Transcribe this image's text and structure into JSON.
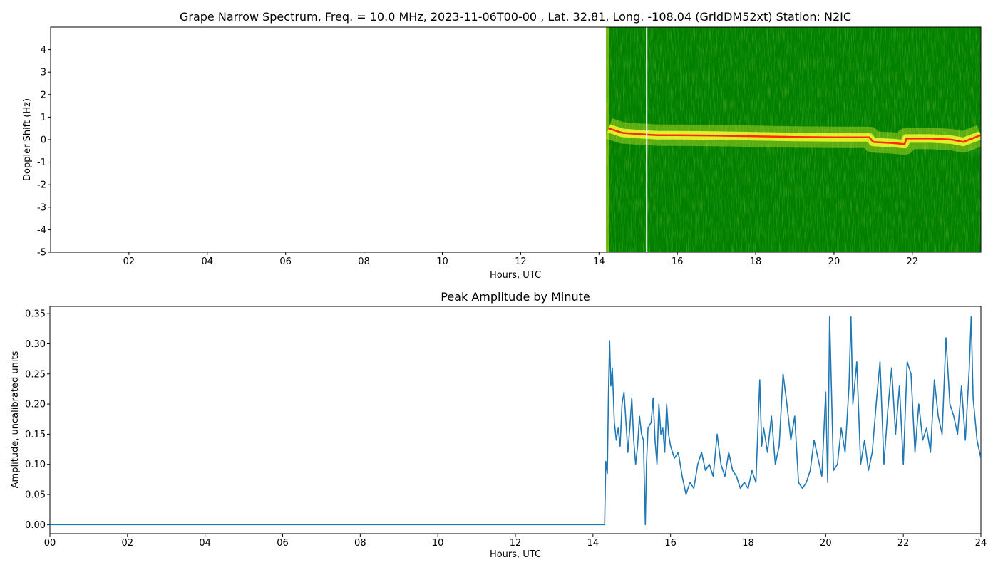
{
  "chart_data": [
    {
      "type": "heatmap",
      "title": "Grape Narrow Spectrum, Freq. = 10.0 MHz, 2023-11-06T00-00 , Lat.  32.81, Long. -108.04 (GridDM52xt) Station: N2IC",
      "xlabel": "Hours, UTC",
      "ylabel": "Doppler Shift (Hz)",
      "xlim": [
        0,
        23.75
      ],
      "ylim": [
        -5,
        5
      ],
      "x_ticks": [
        2,
        4,
        6,
        8,
        10,
        12,
        14,
        16,
        18,
        20,
        22
      ],
      "x_tick_labels": [
        "02",
        "04",
        "06",
        "08",
        "10",
        "12",
        "14",
        "16",
        "18",
        "20",
        "22"
      ],
      "y_ticks": [
        -5,
        -4,
        -3,
        -2,
        -1,
        0,
        1,
        2,
        3,
        4
      ],
      "y_tick_labels": [
        "-5",
        "-4",
        "-3",
        "-2",
        "-1",
        "0",
        "1",
        "2",
        "3",
        "4"
      ],
      "data_start_hour": 14.18,
      "gap_hour": 15.2,
      "colors": {
        "background": "#007f00",
        "band": "#ffff33",
        "peak": "#ff2a00"
      },
      "doppler_trace": [
        [
          14.25,
          0.5
        ],
        [
          14.6,
          0.3
        ],
        [
          15.0,
          0.25
        ],
        [
          15.5,
          0.2
        ],
        [
          16.0,
          0.2
        ],
        [
          17.0,
          0.18
        ],
        [
          18.0,
          0.15
        ],
        [
          19.0,
          0.12
        ],
        [
          20.0,
          0.1
        ],
        [
          20.9,
          0.1
        ],
        [
          21.0,
          -0.1
        ],
        [
          21.5,
          -0.15
        ],
        [
          21.8,
          -0.2
        ],
        [
          21.85,
          0.05
        ],
        [
          22.5,
          0.05
        ],
        [
          23.0,
          0.0
        ],
        [
          23.3,
          -0.1
        ],
        [
          23.75,
          0.2
        ]
      ]
    },
    {
      "type": "line",
      "title": "Peak Amplitude by Minute",
      "xlabel": "Hours, UTC",
      "ylabel": "Amplitude, uncalibrated units",
      "xlim": [
        0,
        24
      ],
      "ylim": [
        -0.015,
        0.362
      ],
      "x_ticks": [
        0,
        2,
        4,
        6,
        8,
        10,
        12,
        14,
        16,
        18,
        20,
        22,
        24
      ],
      "x_tick_labels": [
        "00",
        "02",
        "04",
        "06",
        "08",
        "10",
        "12",
        "14",
        "16",
        "18",
        "20",
        "22",
        "24"
      ],
      "y_ticks": [
        0,
        0.05,
        0.1,
        0.15,
        0.2,
        0.25,
        0.3,
        0.35
      ],
      "y_tick_labels": [
        "0.00",
        "0.05",
        "0.10",
        "0.15",
        "0.20",
        "0.25",
        "0.30",
        "0.35"
      ],
      "line_color": "#1f77b4",
      "x": [
        0,
        14.3,
        14.33,
        14.37,
        14.4,
        14.43,
        14.46,
        14.5,
        14.55,
        14.6,
        14.65,
        14.7,
        14.75,
        14.8,
        14.85,
        14.9,
        14.95,
        15.0,
        15.05,
        15.1,
        15.15,
        15.2,
        15.25,
        15.3,
        15.35,
        15.38,
        15.42,
        15.5,
        15.55,
        15.6,
        15.65,
        15.7,
        15.75,
        15.8,
        15.85,
        15.9,
        15.95,
        16.0,
        16.1,
        16.2,
        16.3,
        16.4,
        16.5,
        16.6,
        16.7,
        16.8,
        16.9,
        17.0,
        17.1,
        17.2,
        17.3,
        17.4,
        17.5,
        17.6,
        17.7,
        17.8,
        17.9,
        18.0,
        18.1,
        18.2,
        18.3,
        18.35,
        18.4,
        18.5,
        18.6,
        18.7,
        18.8,
        18.9,
        19.0,
        19.1,
        19.2,
        19.3,
        19.4,
        19.5,
        19.6,
        19.7,
        19.8,
        19.9,
        20.0,
        20.05,
        20.1,
        20.2,
        20.3,
        20.4,
        20.5,
        20.6,
        20.65,
        20.7,
        20.8,
        20.9,
        21.0,
        21.1,
        21.2,
        21.3,
        21.4,
        21.5,
        21.6,
        21.7,
        21.8,
        21.9,
        22.0,
        22.1,
        22.2,
        22.3,
        22.4,
        22.5,
        22.6,
        22.7,
        22.8,
        22.9,
        23.0,
        23.1,
        23.2,
        23.3,
        23.4,
        23.5,
        23.6,
        23.7,
        23.75,
        23.8,
        23.9,
        24.0
      ],
      "y": [
        0,
        0,
        0.105,
        0.085,
        0.22,
        0.305,
        0.23,
        0.26,
        0.17,
        0.14,
        0.16,
        0.13,
        0.2,
        0.22,
        0.17,
        0.12,
        0.16,
        0.21,
        0.14,
        0.1,
        0.13,
        0.18,
        0.15,
        0.14,
        0.0,
        0.1,
        0.16,
        0.17,
        0.21,
        0.14,
        0.1,
        0.2,
        0.15,
        0.16,
        0.12,
        0.2,
        0.15,
        0.13,
        0.11,
        0.12,
        0.08,
        0.05,
        0.07,
        0.06,
        0.1,
        0.12,
        0.09,
        0.1,
        0.08,
        0.15,
        0.1,
        0.08,
        0.12,
        0.09,
        0.08,
        0.06,
        0.07,
        0.06,
        0.09,
        0.07,
        0.24,
        0.13,
        0.16,
        0.12,
        0.18,
        0.1,
        0.13,
        0.25,
        0.2,
        0.14,
        0.18,
        0.07,
        0.06,
        0.07,
        0.09,
        0.14,
        0.11,
        0.08,
        0.22,
        0.07,
        0.345,
        0.09,
        0.1,
        0.16,
        0.12,
        0.23,
        0.345,
        0.2,
        0.27,
        0.1,
        0.14,
        0.09,
        0.12,
        0.2,
        0.27,
        0.1,
        0.19,
        0.26,
        0.15,
        0.23,
        0.1,
        0.27,
        0.25,
        0.12,
        0.2,
        0.14,
        0.16,
        0.12,
        0.24,
        0.18,
        0.15,
        0.31,
        0.2,
        0.18,
        0.15,
        0.23,
        0.14,
        0.26,
        0.345,
        0.21,
        0.14,
        0.11,
        0.09
      ]
    }
  ]
}
